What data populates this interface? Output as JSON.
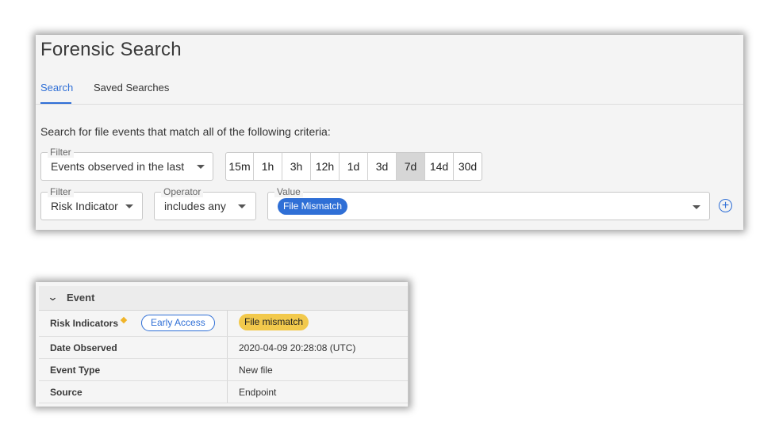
{
  "search_panel": {
    "title": "Forensic Search",
    "tabs": [
      {
        "label": "Search",
        "active": true
      },
      {
        "label": "Saved Searches",
        "active": false
      }
    ],
    "criteria_text": "Search for file events that match all of the following criteria:",
    "time_filter": {
      "legend": "Filter",
      "value": "Events observed in the last",
      "ranges": [
        "15m",
        "1h",
        "3h",
        "12h",
        "1d",
        "3d",
        "7d",
        "14d",
        "30d"
      ],
      "selected": "7d"
    },
    "filter": {
      "legend": "Filter",
      "value": "Risk Indicator"
    },
    "operator": {
      "legend": "Operator",
      "value": "includes any"
    },
    "value_field": {
      "legend": "Value",
      "chips": [
        "File Mismatch"
      ]
    },
    "add_icon": "plus-circle-icon"
  },
  "event_panel": {
    "header": "Event",
    "collapse_icon": "chevron-down-icon",
    "rows": [
      {
        "key": "Risk Indicators",
        "badge": "Early Access",
        "value": "File mismatch"
      },
      {
        "key": "Date Observed",
        "value": "2020-04-09 20:28:08 (UTC)"
      },
      {
        "key": "Event Type",
        "value": "New file"
      },
      {
        "key": "Source",
        "value": "Endpoint"
      }
    ]
  },
  "colors": {
    "accent": "#2f6fd6",
    "warning_badge": "#f2c94c",
    "selected_range": "#d6d6d6"
  }
}
